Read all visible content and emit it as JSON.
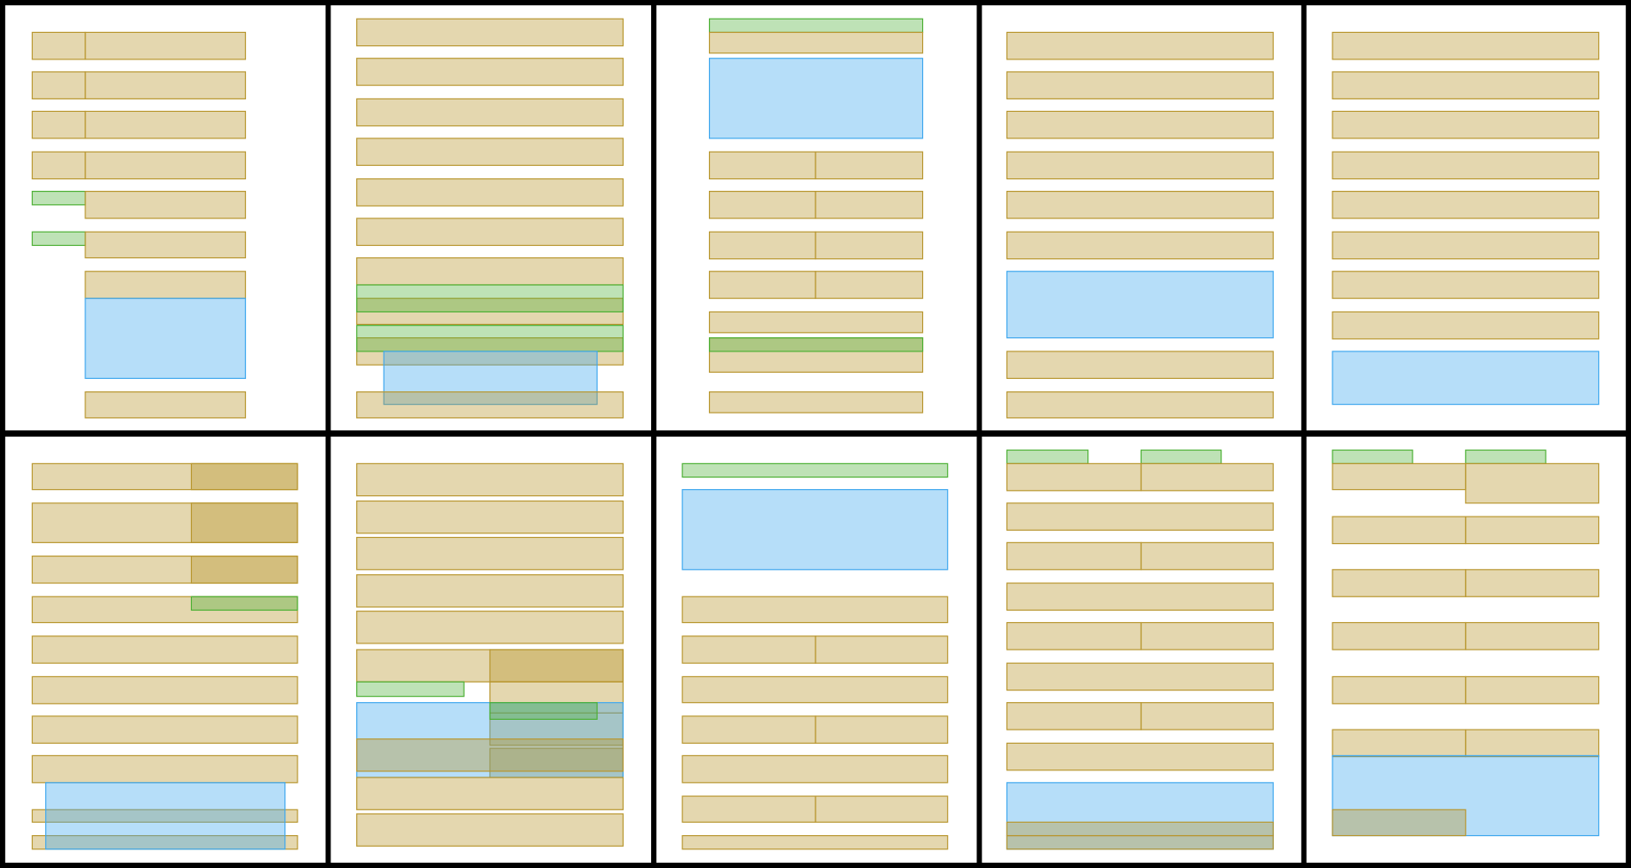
{
  "colors": {
    "background": "#ffffff",
    "grid_border": "#000000",
    "tan_fill": "rgba(184,150,46,0.38)",
    "tan_stroke": "#b8962e",
    "green_fill": "rgba(76,176,52,0.36)",
    "green_stroke": "#4cb034",
    "blue_fill": "rgba(62,167,238,0.38)",
    "blue_stroke": "#3ea7ee"
  }
}
